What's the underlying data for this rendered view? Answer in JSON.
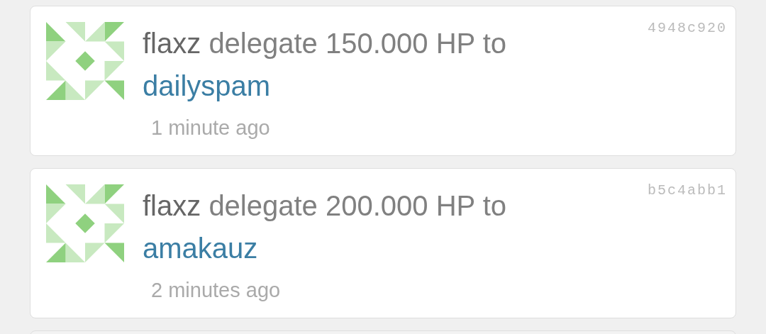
{
  "feed": [
    {
      "user": "flaxz",
      "action": "delegate 150.000 HP to",
      "target": "dailyspam",
      "time": "1 minute ago",
      "hash": "4948c920"
    },
    {
      "user": "flaxz",
      "action": "delegate 200.000 HP to",
      "target": "amakauz",
      "time": "2 minutes ago",
      "hash": "b5c4abb1"
    }
  ]
}
